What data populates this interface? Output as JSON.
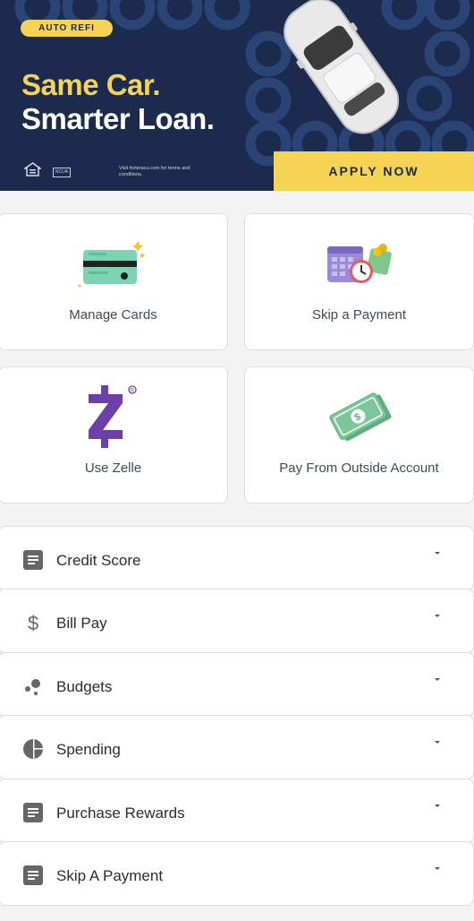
{
  "banner": {
    "badge": "AUTO REFI",
    "headline_line1": "Same Car.",
    "headline_line2": "Smarter Loan.",
    "ncua": "NCUA",
    "disclaimer": "Visit forteracu.com for terms and conditions.",
    "apply_label": "APPLY NOW",
    "colors": {
      "navy": "#1b2a4d",
      "yellow": "#f5d453",
      "ring": "#2a4575"
    }
  },
  "tiles": [
    {
      "label": "Manage Cards",
      "icon": "credit-card-icon"
    },
    {
      "label": "Skip a Payment",
      "icon": "calendar-clock-money-icon"
    },
    {
      "label": "Use Zelle",
      "icon": "zelle-logo-icon"
    },
    {
      "label": "Pay From Outside Account",
      "icon": "cash-bills-icon"
    }
  ],
  "accordion": [
    {
      "label": "Credit Score",
      "icon": "document-icon"
    },
    {
      "label": "Bill Pay",
      "icon": "dollar-icon"
    },
    {
      "label": "Budgets",
      "icon": "circles-icon"
    },
    {
      "label": "Spending",
      "icon": "pie-chart-icon"
    },
    {
      "label": "Purchase Rewards",
      "icon": "document-icon"
    },
    {
      "label": "Skip A Payment",
      "icon": "document-icon"
    }
  ]
}
